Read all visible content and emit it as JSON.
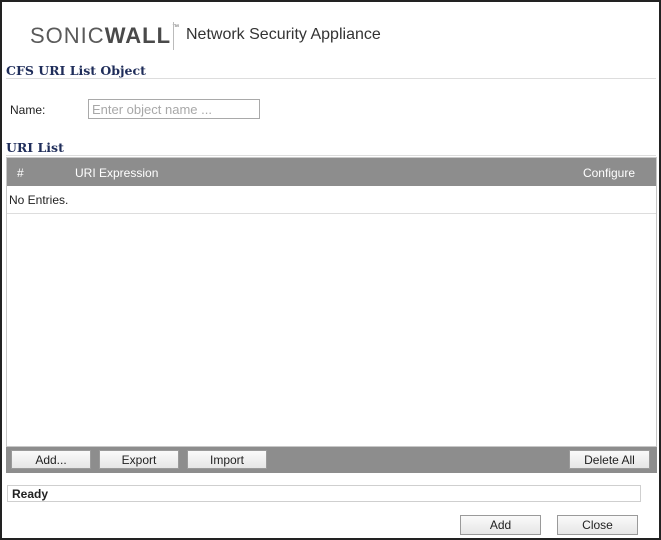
{
  "header": {
    "brand_regular": "SONIC",
    "brand_bold": "WALL",
    "brand_tm": "™",
    "app_name": "Network Security Appliance"
  },
  "object_section": {
    "title": "CFS URI List Object",
    "name_label": "Name:",
    "name_placeholder": "Enter object name ...",
    "name_value": ""
  },
  "uri_list": {
    "title": "URI List",
    "columns": [
      "#",
      "URI Expression",
      "Configure"
    ],
    "empty_text": "No Entries."
  },
  "toolbar": {
    "add_label": "Add...",
    "export_label": "Export",
    "import_label": "Import",
    "delete_all_label": "Delete All"
  },
  "status": {
    "text": "Ready"
  },
  "footer": {
    "add_label": "Add",
    "close_label": "Close"
  }
}
